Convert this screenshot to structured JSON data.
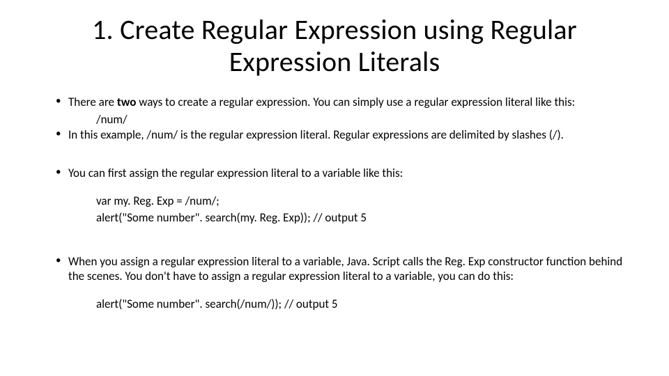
{
  "title": "1. Create Regular Expression using Regular Expression Literals",
  "b1_pre": "There are ",
  "b1_bold": "two",
  "b1_post": " ways to create a regular expression. You can simply use a regular expression literal like this:",
  "code1": "/num/",
  "b2": "In this example, /num/ is the regular expression literal. Regular expressions are delimited by slashes (/).",
  "b3": "You can first assign the regular expression literal to a variable like this:",
  "code2a": "var my. Reg. Exp = /num/;",
  "code2b": "alert(\"Some number\". search(my. Reg. Exp));  // output 5",
  "b4": "When you assign a regular expression literal to a variable, Java. Script calls the Reg. Exp constructor function behind the scenes. You don't have to assign a regular expression literal to a variable, you can do this:",
  "code3": "alert(\"Some number\". search(/num/));  // output 5"
}
